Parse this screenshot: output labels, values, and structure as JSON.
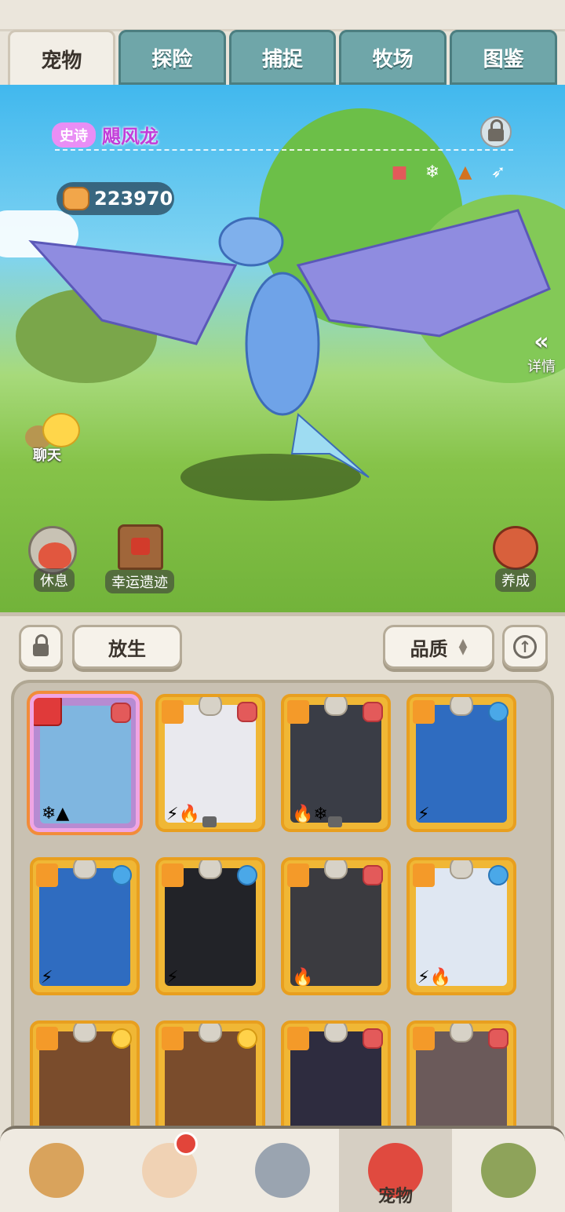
{
  "tabs": [
    {
      "label": "宠物",
      "active": true
    },
    {
      "label": "探险",
      "active": false
    },
    {
      "label": "捕捉",
      "active": false
    },
    {
      "label": "牧场",
      "active": false
    },
    {
      "label": "图鉴",
      "active": false
    }
  ],
  "pet": {
    "rarity": "史诗",
    "name": "飓风龙",
    "attributes": [
      "paw-icon",
      "snowflake-icon",
      "mountain-icon",
      "wing-icon"
    ]
  },
  "currency": {
    "value": "223970",
    "icon": "paw-coin-icon"
  },
  "scene_buttons": {
    "detail": "详情",
    "chat": "聊天",
    "rest": "休息",
    "lucky": "幸运遗迹",
    "train": "养成"
  },
  "controls": {
    "release": "放生",
    "quality": "品质"
  },
  "cards": [
    {
      "tag": "paw",
      "glyphs": "❄▲",
      "locked": false,
      "selected": true,
      "color": "#7fb6e0"
    },
    {
      "tag": "paw",
      "glyphs": "⚡🔥",
      "locked": true,
      "selected": false,
      "color": "#e9e9ee"
    },
    {
      "tag": "paw",
      "glyphs": "🔥❄",
      "locked": true,
      "selected": false,
      "color": "#3a3d46"
    },
    {
      "tag": "water",
      "glyphs": "⚡",
      "locked": false,
      "selected": false,
      "color": "#2f6cc0"
    },
    {
      "tag": "water",
      "glyphs": "⚡",
      "locked": false,
      "selected": false,
      "color": "#2f6cc0"
    },
    {
      "tag": "water",
      "glyphs": "⚡",
      "locked": false,
      "selected": false,
      "color": "#222328"
    },
    {
      "tag": "paw",
      "glyphs": "🔥",
      "locked": false,
      "selected": false,
      "color": "#3b3b40"
    },
    {
      "tag": "water",
      "glyphs": "⚡🔥",
      "locked": false,
      "selected": false,
      "color": "#dfe7f2"
    },
    {
      "tag": "gold",
      "glyphs": "",
      "locked": false,
      "selected": false,
      "color": "#7a4c2c"
    },
    {
      "tag": "gold",
      "glyphs": "",
      "locked": false,
      "selected": false,
      "color": "#7a4c2c"
    },
    {
      "tag": "paw",
      "glyphs": "",
      "locked": false,
      "selected": false,
      "color": "#2e2c3f"
    },
    {
      "tag": "paw",
      "glyphs": "",
      "locked": false,
      "selected": false,
      "color": "#6b5a5a"
    }
  ],
  "bottom_nav": [
    {
      "name": "nav-tribe",
      "label": "",
      "color": "#d9a35c"
    },
    {
      "name": "nav-hero",
      "label": "",
      "color": "#f0d2b4",
      "notify": true
    },
    {
      "name": "nav-weapon",
      "label": "",
      "color": "#9aa4b0"
    },
    {
      "name": "nav-pets",
      "label": "宠物",
      "color": "#e04a3f",
      "active": true
    },
    {
      "name": "nav-totem",
      "label": "",
      "color": "#8ea35a"
    }
  ]
}
